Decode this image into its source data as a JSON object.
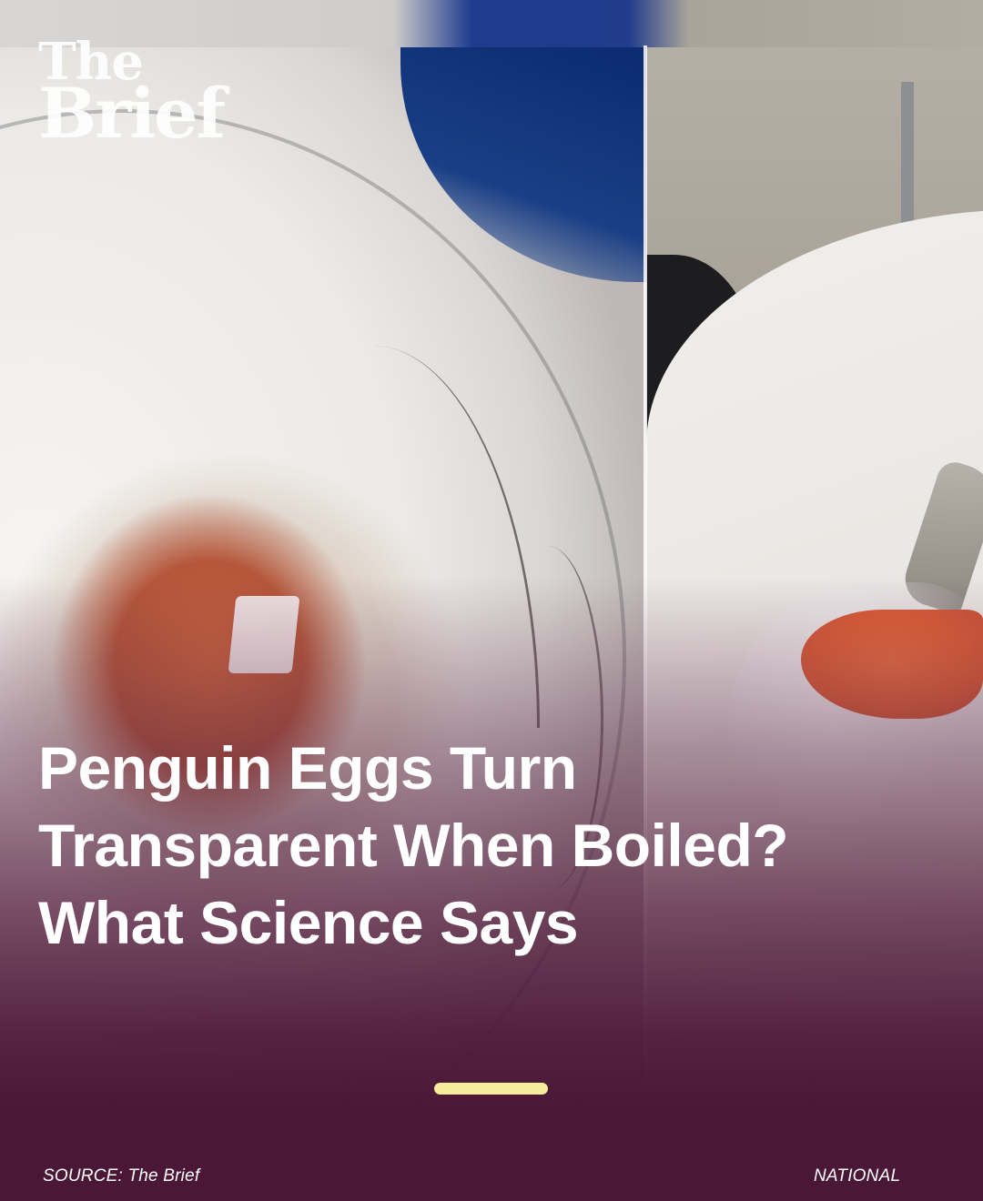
{
  "brand": {
    "logo_line1": "The",
    "logo_line2": "Brief",
    "indicator_color": "#f7ec9c",
    "overlay_color": "#4a1836"
  },
  "headline": {
    "line1": "Penguin Eggs Turn",
    "line2": "Transparent When Boiled?",
    "line3": "What Science Says"
  },
  "footer": {
    "source": "SOURCE: The Brief",
    "category": "NATIONAL"
  }
}
